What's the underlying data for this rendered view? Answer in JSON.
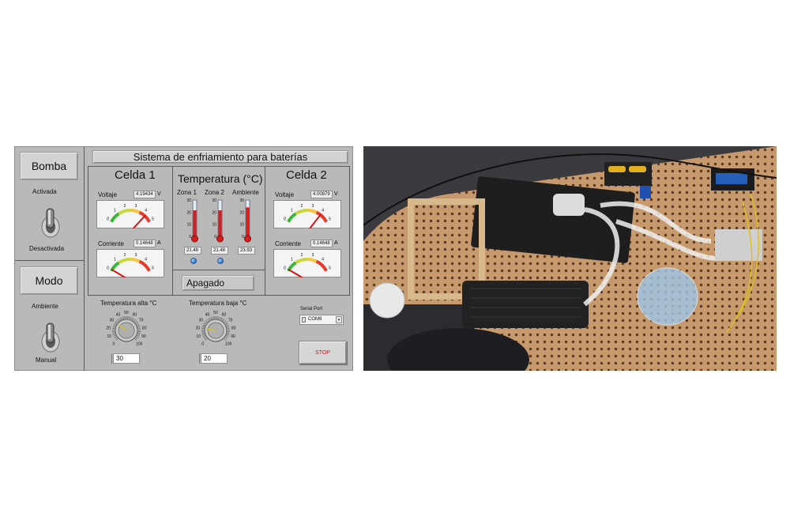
{
  "panel": {
    "title": "Sistema de enfriamiento para baterías",
    "pump": {
      "label": "Bomba",
      "on_label": "Activada",
      "off_label": "Desactivada"
    },
    "mode": {
      "label": "Modo",
      "on_label": "Ambiente",
      "off_label": "Manual"
    },
    "cell1": {
      "title": "Celda 1",
      "voltage_label": "Voltaje",
      "voltage_value": "4.19434",
      "voltage_unit": "V",
      "voltage_reading": 4.19434,
      "current_label": "Corriente",
      "current_value": "0.14648",
      "current_unit": "A",
      "current_reading": 0.14648
    },
    "cell2": {
      "title": "Celda 2",
      "voltage_label": "Voltaje",
      "voltage_value": "4.00879",
      "voltage_unit": "V",
      "voltage_reading": 4.00879,
      "current_label": "Corriente",
      "current_value": "0.14648",
      "current_unit": "A",
      "current_reading": 0.14648
    },
    "meter_ticks": [
      "0",
      "1",
      "2",
      "3",
      "4",
      "5"
    ],
    "temperature": {
      "title": "Temperatura (°C)",
      "zones": [
        {
          "label": "Zona 1",
          "value": "21.48",
          "reading": 21.48,
          "led": true
        },
        {
          "label": "Zona 2",
          "value": "21.48",
          "reading": 21.48,
          "led": true
        },
        {
          "label": "Ambiente",
          "value": "23.93",
          "reading": 23.93,
          "led": false
        }
      ],
      "scale_ticks": [
        "30",
        "20",
        "10",
        "0"
      ]
    },
    "status": "Apagado",
    "high_temp": {
      "label": "Temperatura alta °C",
      "value": "30",
      "reading": 30
    },
    "low_temp": {
      "label": "Temperatura baja °C",
      "value": "20",
      "reading": 20
    },
    "knob_ticks": [
      "0",
      "10",
      "20",
      "30",
      "40",
      "50",
      "60",
      "70",
      "80",
      "90",
      "100"
    ],
    "serial": {
      "label": "Serial Port",
      "value": "COM8"
    },
    "stop_label": "STOP"
  }
}
